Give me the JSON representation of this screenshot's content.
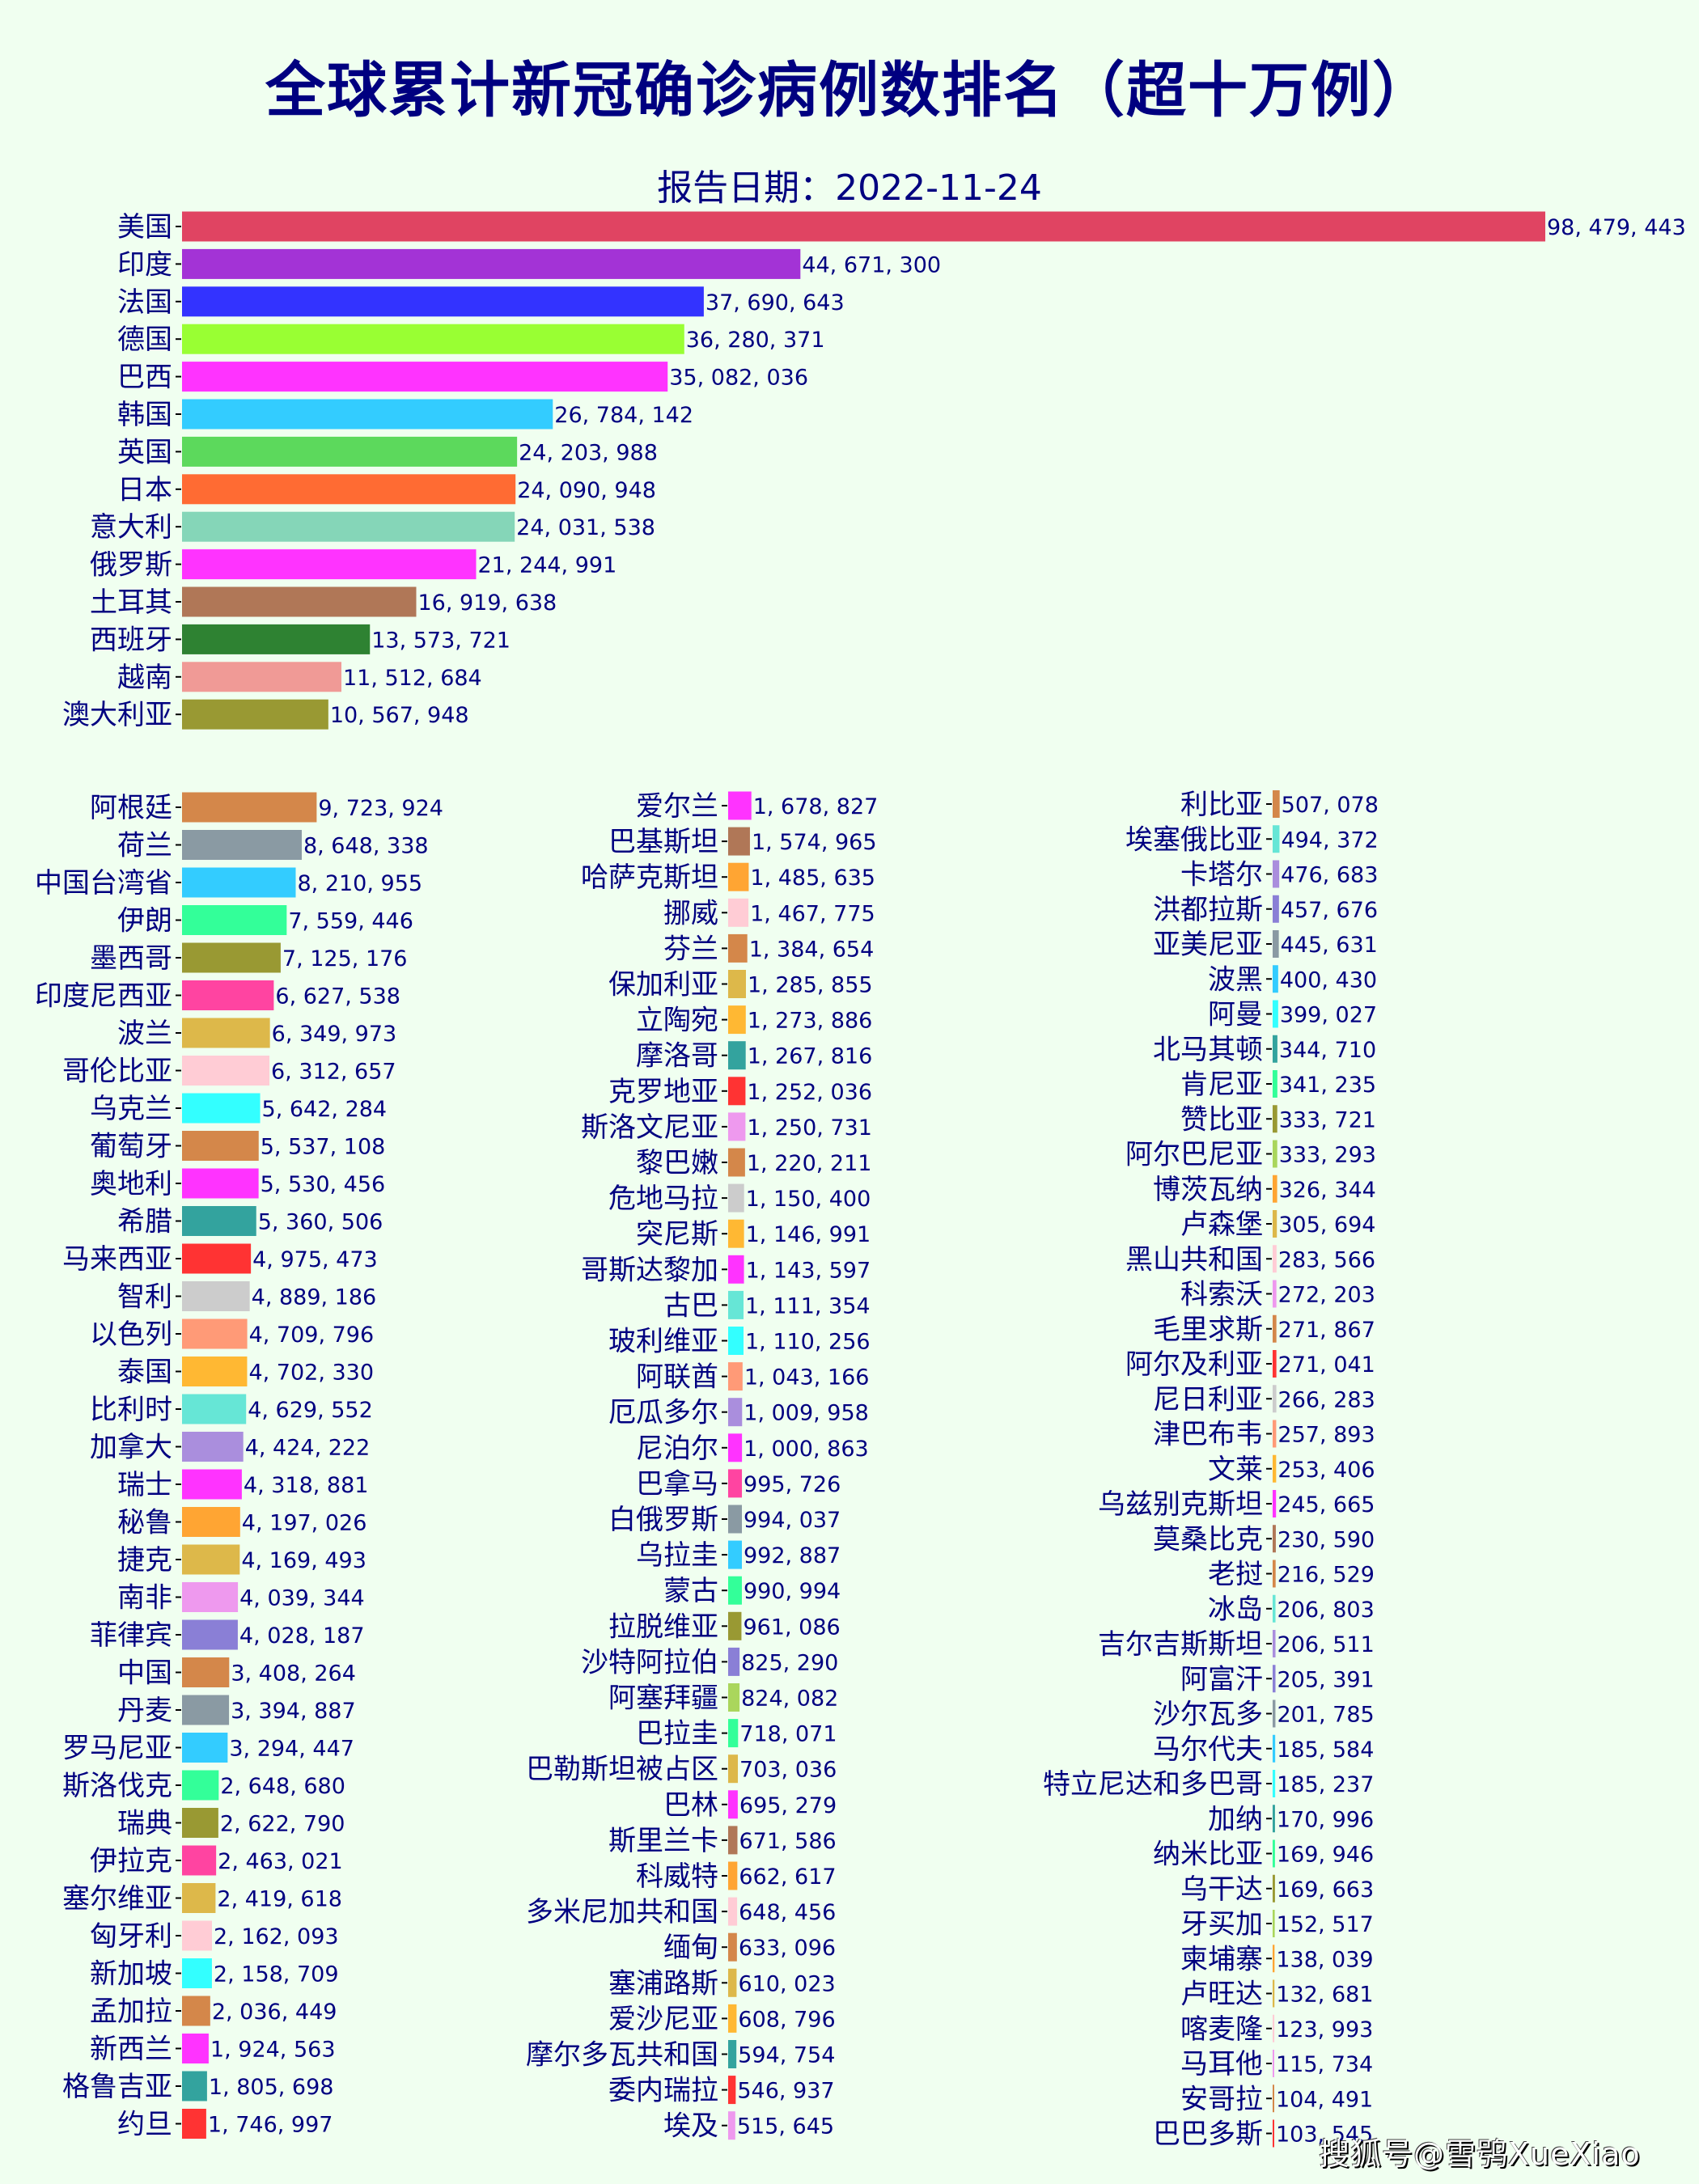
{
  "chart_data": {
    "type": "bar",
    "orientation": "horizontal",
    "title": "全球累计新冠确诊病例数排名（超十万例）",
    "subtitle": "报告日期：2022-11-24",
    "xlabel": "",
    "ylabel": "",
    "grid": false,
    "legend": "none",
    "panels": [
      {
        "name": "top",
        "categories": [
          "美国",
          "印度",
          "法国",
          "德国",
          "巴西",
          "韩国",
          "英国",
          "日本",
          "意大利",
          "俄罗斯",
          "土耳其",
          "西班牙",
          "越南",
          "澳大利亚"
        ],
        "values": [
          98479443,
          44671300,
          37690643,
          36280371,
          35082036,
          26784142,
          24203988,
          24090948,
          24031538,
          21244991,
          16919638,
          13573721,
          11512684,
          10567948
        ],
        "labels": [
          "98, 479, 443",
          "44, 671, 300",
          "37, 690, 643",
          "36, 280, 371",
          "35, 082, 036",
          "26, 784, 142",
          "24, 203, 988",
          "24, 090, 948",
          "24, 031, 538",
          "21, 244, 991",
          "16, 919, 638",
          "13, 573, 721",
          "11, 512, 684",
          "10, 567, 948"
        ],
        "colors": [
          "#E04462",
          "#A333D6",
          "#3333FF",
          "#99FF33",
          "#FF33FF",
          "#33CCFF",
          "#5CD95C",
          "#FF6B33",
          "#85D6B8",
          "#FF33FF",
          "#B07757",
          "#2E8232",
          "#F09A96",
          "#999933"
        ]
      },
      {
        "name": "left",
        "categories": [
          "阿根廷",
          "荷兰",
          "中国台湾省",
          "伊朗",
          "墨西哥",
          "印度尼西亚",
          "波兰",
          "哥伦比亚",
          "乌克兰",
          "葡萄牙",
          "奥地利",
          "希腊",
          "马来西亚",
          "智利",
          "以色列",
          "泰国",
          "比利时",
          "加拿大",
          "瑞士",
          "秘鲁",
          "捷克",
          "南非",
          "菲律宾",
          "中国",
          "丹麦",
          "罗马尼亚",
          "斯洛伐克",
          "瑞典",
          "伊拉克",
          "塞尔维亚",
          "匈牙利",
          "新加坡",
          "孟加拉",
          "新西兰",
          "格鲁吉亚",
          "约旦"
        ],
        "values": [
          9723924,
          8648338,
          8210955,
          7559446,
          7125176,
          6627538,
          6349973,
          6312657,
          5642284,
          5537108,
          5530456,
          5360506,
          4975473,
          4889186,
          4709796,
          4702330,
          4629552,
          4424222,
          4318881,
          4197026,
          4169493,
          4039344,
          4028187,
          3408264,
          3394887,
          3294447,
          2648680,
          2622790,
          2463021,
          2419618,
          2162093,
          2158709,
          2036449,
          1924563,
          1805698,
          1746997
        ],
        "labels": [
          "9, 723, 924",
          "8, 648, 338",
          "8, 210, 955",
          "7, 559, 446",
          "7, 125, 176",
          "6, 627, 538",
          "6, 349, 973",
          "6, 312, 657",
          "5, 642, 284",
          "5, 537, 108",
          "5, 530, 456",
          "5, 360, 506",
          "4, 975, 473",
          "4, 889, 186",
          "4, 709, 796",
          "4, 702, 330",
          "4, 629, 552",
          "4, 424, 222",
          "4, 318, 881",
          "4, 197, 026",
          "4, 169, 493",
          "4, 039, 344",
          "4, 028, 187",
          "3, 408, 264",
          "3, 394, 887",
          "3, 294, 447",
          "2, 648, 680",
          "2, 622, 790",
          "2, 463, 021",
          "2, 419, 618",
          "2, 162, 093",
          "2, 158, 709",
          "2, 036, 449",
          "1, 924, 563",
          "1, 805, 698",
          "1, 746, 997"
        ],
        "colors": [
          "#D4874A",
          "#8A9AA3",
          "#33CCFF",
          "#33FF99",
          "#999933",
          "#FF44A1",
          "#DDB84A",
          "#FFCCD5",
          "#33FFFF",
          "#D4874A",
          "#FF33FF",
          "#33A39E",
          "#FF3333",
          "#CCCCCC",
          "#FF9A77",
          "#FFB833",
          "#66E6D6",
          "#AA8EDD",
          "#FF33FF",
          "#FFA533",
          "#DDB84A",
          "#EE99EE",
          "#8A7FD6",
          "#D4874A",
          "#8A9AA3",
          "#33CCFF",
          "#33FF99",
          "#999933",
          "#FF44A1",
          "#DDB84A",
          "#FFCCD5",
          "#33FFFF",
          "#D4874A",
          "#FF33FF",
          "#33A39E",
          "#FF3333"
        ]
      },
      {
        "name": "middle",
        "categories": [
          "爱尔兰",
          "巴基斯坦",
          "哈萨克斯坦",
          "挪威",
          "芬兰",
          "保加利亚",
          "立陶宛",
          "摩洛哥",
          "克罗地亚",
          "斯洛文尼亚",
          "黎巴嫩",
          "危地马拉",
          "突尼斯",
          "哥斯达黎加",
          "古巴",
          "玻利维亚",
          "阿联酋",
          "厄瓜多尔",
          "尼泊尔",
          "巴拿马",
          "白俄罗斯",
          "乌拉圭",
          "蒙古",
          "拉脱维亚",
          "沙特阿拉伯",
          "阿塞拜疆",
          "巴拉圭",
          "巴勒斯坦被占区",
          "巴林",
          "斯里兰卡",
          "科威特",
          "多米尼加共和国",
          "缅甸",
          "塞浦路斯",
          "爱沙尼亚",
          "摩尔多瓦共和国",
          "委内瑞拉",
          "埃及"
        ],
        "values": [
          1678827,
          1574965,
          1485635,
          1467775,
          1384654,
          1285855,
          1273886,
          1267816,
          1252036,
          1250731,
          1220211,
          1150400,
          1146991,
          1143597,
          1111354,
          1110256,
          1043166,
          1009958,
          1000863,
          995726,
          994037,
          992887,
          990994,
          961086,
          825290,
          824082,
          718071,
          703036,
          695279,
          671586,
          662617,
          648456,
          633096,
          610023,
          608796,
          594754,
          546937,
          515645
        ],
        "labels": [
          "1, 678, 827",
          "1, 574, 965",
          "1, 485, 635",
          "1, 467, 775",
          "1, 384, 654",
          "1, 285, 855",
          "1, 273, 886",
          "1, 267, 816",
          "1, 252, 036",
          "1, 250, 731",
          "1, 220, 211",
          "1, 150, 400",
          "1, 146, 991",
          "1, 143, 597",
          "1, 111, 354",
          "1, 110, 256",
          "1, 043, 166",
          "1, 009, 958",
          "1, 000, 863",
          "995, 726",
          "994, 037",
          "992, 887",
          "990, 994",
          "961, 086",
          "825, 290",
          "824, 082",
          "718, 071",
          "703, 036",
          "695, 279",
          "671, 586",
          "662, 617",
          "648, 456",
          "633, 096",
          "610, 023",
          "608, 796",
          "594, 754",
          "546, 937",
          "515, 645"
        ],
        "colors": [
          "#FF33FF",
          "#B07757",
          "#FFA533",
          "#FFCCD5",
          "#D4874A",
          "#DDB84A",
          "#FFB833",
          "#33A39E",
          "#FF3333",
          "#EE99EE",
          "#D4874A",
          "#CCCCCC",
          "#FFB833",
          "#FF33FF",
          "#66E6D6",
          "#33FFFF",
          "#FF9A77",
          "#AA8EDD",
          "#FF33FF",
          "#FF44A1",
          "#8A9AA3",
          "#33CCFF",
          "#33FF99",
          "#999933",
          "#8A7FD6",
          "#AAD65C",
          "#33FF99",
          "#DDB84A",
          "#FF33FF",
          "#B07757",
          "#FFA533",
          "#FFCCD5",
          "#D4874A",
          "#DDB84A",
          "#FFB833",
          "#33A39E",
          "#FF3333",
          "#EE99EE"
        ]
      },
      {
        "name": "right",
        "categories": [
          "利比亚",
          "埃塞俄比亚",
          "卡塔尔",
          "洪都拉斯",
          "亚美尼亚",
          "波黑",
          "阿曼",
          "北马其顿",
          "肯尼亚",
          "赞比亚",
          "阿尔巴尼亚",
          "博茨瓦纳",
          "卢森堡",
          "黑山共和国",
          "科索沃",
          "毛里求斯",
          "阿尔及利亚",
          "尼日利亚",
          "津巴布韦",
          "文莱",
          "乌兹别克斯坦",
          "莫桑比克",
          "老挝",
          "冰岛",
          "吉尔吉斯斯坦",
          "阿富汗",
          "沙尔瓦多",
          "马尔代夫",
          "特立尼达和多巴哥",
          "加纳",
          "纳米比亚",
          "乌干达",
          "牙买加",
          "柬埔寨",
          "卢旺达",
          "喀麦隆",
          "马耳他",
          "安哥拉",
          "巴巴多斯"
        ],
        "values": [
          507078,
          494372,
          476683,
          457676,
          445631,
          400430,
          399027,
          344710,
          341235,
          333721,
          333293,
          326344,
          305694,
          283566,
          272203,
          271867,
          271041,
          266283,
          257893,
          253406,
          245665,
          230590,
          216529,
          206803,
          206511,
          205391,
          201785,
          185584,
          185237,
          170996,
          169946,
          169663,
          152517,
          138039,
          132681,
          123993,
          115734,
          104491,
          103545
        ],
        "labels": [
          "507, 078",
          "494, 372",
          "476, 683",
          "457, 676",
          "445, 631",
          "400, 430",
          "399, 027",
          "344, 710",
          "341, 235",
          "333, 721",
          "333, 293",
          "326, 344",
          "305, 694",
          "283, 566",
          "272, 203",
          "271, 867",
          "271, 041",
          "266, 283",
          "257, 893",
          "253, 406",
          "245, 665",
          "230, 590",
          "216, 529",
          "206, 803",
          "206, 511",
          "205, 391",
          "201, 785",
          "185, 584",
          "185, 237",
          "170, 996",
          "169, 946",
          "169, 663",
          "152, 517",
          "138, 039",
          "132, 681",
          "123, 993",
          "115, 734",
          "104, 491",
          "103, 545"
        ],
        "colors": [
          "#D4874A",
          "#66E6D6",
          "#AA8EDD",
          "#8A7FD6",
          "#8A9AA3",
          "#33CCFF",
          "#33FFFF",
          "#33A39E",
          "#33FF99",
          "#999933",
          "#AAD65C",
          "#FFA533",
          "#DDB84A",
          "#FFCCD5",
          "#EE99EE",
          "#D4874A",
          "#FF3333",
          "#CCCCCC",
          "#FF9A77",
          "#FFB833",
          "#FF33FF",
          "#B07757",
          "#D4874A",
          "#66E6D6",
          "#AA8EDD",
          "#8A7FD6",
          "#8A9AA3",
          "#33CCFF",
          "#33FFFF",
          "#33A39E",
          "#33FF99",
          "#999933",
          "#AAD65C",
          "#FFA533",
          "#DDB84A",
          "#FFCCD5",
          "#EE99EE",
          "#D4874A",
          "#FF3333"
        ]
      }
    ]
  },
  "watermark": "搜狐号@雪鸮XueXiao"
}
